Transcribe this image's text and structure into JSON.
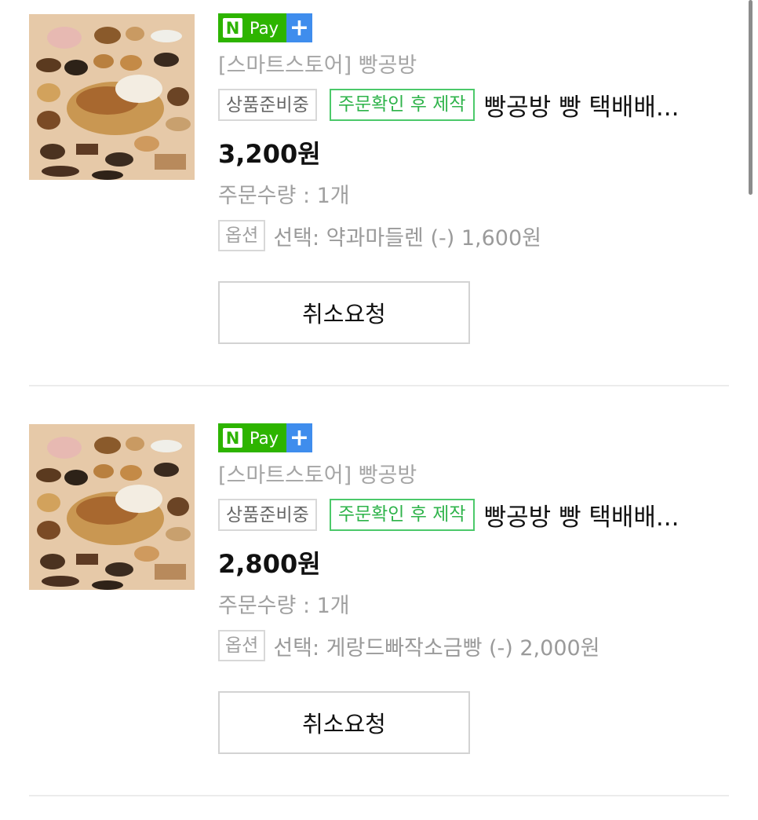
{
  "npay": {
    "n_label": "N",
    "pay_label": "Pay",
    "plus_label": "+"
  },
  "orders": [
    {
      "store": "[스마트스토어] 빵공방",
      "status_tag": "상품준비중",
      "make_tag": "주문확인 후 제작",
      "product_name": "빵공방 빵 택배배...",
      "price": "3,200원",
      "quantity": "주문수량 : 1개",
      "option_tag": "옵션",
      "option_text": "선택: 약과마들렌 (-) 1,600원",
      "cancel_label": "취소요청"
    },
    {
      "store": "[스마트스토어] 빵공방",
      "status_tag": "상품준비중",
      "make_tag": "주문확인 후 제작",
      "product_name": "빵공방 빵 택배배...",
      "price": "2,800원",
      "quantity": "주문수량 : 1개",
      "option_tag": "옵션",
      "option_text": "선택: 게랑드빠작소금빵 (-) 2,000원",
      "cancel_label": "취소요청"
    }
  ],
  "colors": {
    "npay_green": "#2db400",
    "npay_blue": "#3f8ded",
    "tag_green": "#2eb34a"
  }
}
